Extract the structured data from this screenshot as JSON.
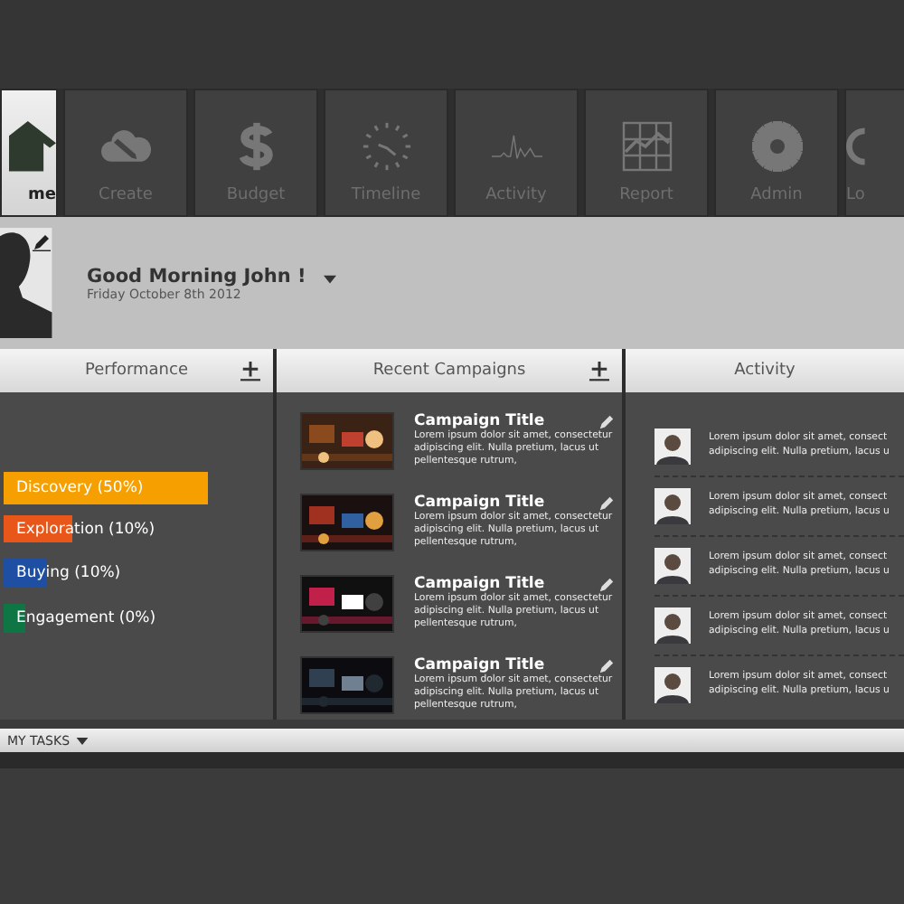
{
  "nav": [
    {
      "label": "me",
      "kind": "home",
      "selected": true
    },
    {
      "label": "Create",
      "kind": "create",
      "selected": false
    },
    {
      "label": "Budget",
      "kind": "budget",
      "selected": false
    },
    {
      "label": "Timeline",
      "kind": "timeline",
      "selected": false
    },
    {
      "label": "Activity",
      "kind": "activity",
      "selected": false
    },
    {
      "label": "Report",
      "kind": "report",
      "selected": false
    },
    {
      "label": "Admin",
      "kind": "admin",
      "selected": false
    },
    {
      "label": "Lo",
      "kind": "logout",
      "selected": false
    }
  ],
  "profile": {
    "greeting": "Good Morning John !",
    "date": "Friday October 8th 2012"
  },
  "performance": {
    "title": "Performance",
    "items": [
      {
        "label": "Discovery (50%)",
        "color": "#f5a000"
      },
      {
        "label": "Exploration (10%)",
        "color": "#e8561a"
      },
      {
        "label": "Buying (10%)",
        "color": "#1f4fa3"
      },
      {
        "label": "Engagement (0%)",
        "color": "#0e7545"
      }
    ]
  },
  "campaigns": {
    "title": "Recent Campaigns",
    "items": [
      {
        "title": "Campaign Title",
        "text": "Lorem ipsum dolor sit amet, consectetur adipiscing elit. Nulla pretium, lacus ut pellentesque rutrum,"
      },
      {
        "title": "Campaign Title",
        "text": "Lorem ipsum dolor sit amet, consectetur adipiscing elit. Nulla pretium, lacus ut pellentesque rutrum,"
      },
      {
        "title": "Campaign Title",
        "text": "Lorem ipsum dolor sit amet, consectetur adipiscing elit. Nulla pretium, lacus ut pellentesque rutrum,"
      },
      {
        "title": "Campaign Title",
        "text": "Lorem ipsum dolor sit amet, consectetur adipiscing elit. Nulla pretium, lacus ut pellentesque rutrum,"
      }
    ]
  },
  "activity": {
    "title": "Activity",
    "items": [
      {
        "line_1": "Lorem ipsum dolor sit amet, consect",
        "line_2": "adipiscing elit. Nulla pretium, lacus u"
      },
      {
        "line_1": "Lorem ipsum dolor sit amet, consect",
        "line_2": "adipiscing elit. Nulla pretium, lacus u"
      },
      {
        "line_1": "Lorem ipsum dolor sit amet, consect",
        "line_2": "adipiscing elit. Nulla pretium, lacus u"
      },
      {
        "line_1": "Lorem ipsum dolor sit amet, consect",
        "line_2": "adipiscing elit. Nulla pretium, lacus u"
      },
      {
        "line_1": "Lorem ipsum dolor sit amet, consect",
        "line_2": "adipiscing elit. Nulla pretium, lacus u"
      }
    ]
  },
  "tasks": {
    "label": "MY TASKS"
  }
}
